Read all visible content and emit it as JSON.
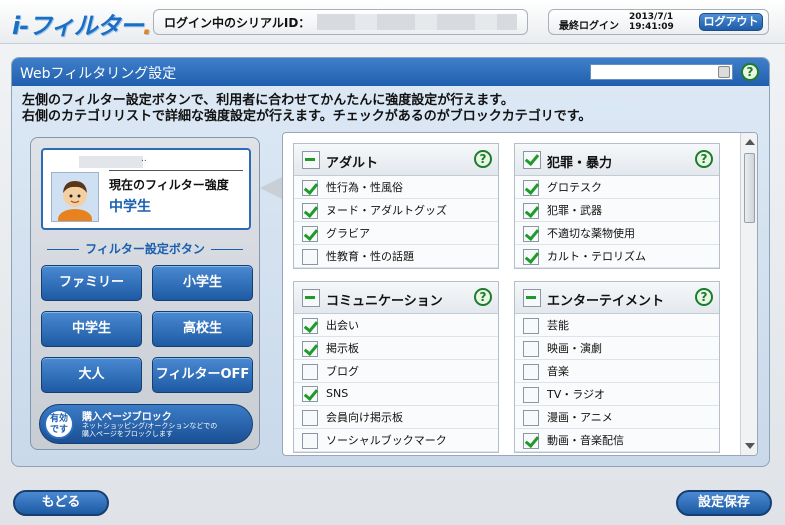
{
  "header": {
    "logo_text": "i-フィルター",
    "logo_dot": ".",
    "serial_label": "ログイン中のシリアルID：",
    "last_login_label": "最終ログイン",
    "last_login_date": "2013/7/1",
    "last_login_time": "19:41:09",
    "logout_label": "ログアウト"
  },
  "panel": {
    "title": "Webフィルタリング設定",
    "help_glyph": "?",
    "instruction_line1": "左側のフィルター設定ボタンで、利用者に合わせてかんたんに強度設定が行えます。",
    "instruction_line2": "右側のカテゴリリストで詳細な強度設定が行えます。チェックがあるのがブロックカテゴリです。"
  },
  "current_filter": {
    "dots": "..",
    "label": "現在のフィルター強度",
    "value": "中学生"
  },
  "filter_buttons": {
    "section_title": "フィルター設定ボタン",
    "family": "ファミリー",
    "elementary": "小学生",
    "junior_high": "中学生",
    "high_school": "高校生",
    "adult": "大人",
    "off": "フィルターOFF"
  },
  "purchase_block": {
    "badge_line1": "有効",
    "badge_line2": "です",
    "title": "購入ページブロック",
    "desc_line1": "ネットショッピング/オークションなどでの",
    "desc_line2": "購入ページをブロックします"
  },
  "categories": {
    "adult": {
      "title": "アダルト",
      "items": [
        {
          "label": "性行為・性風俗",
          "checked": true
        },
        {
          "label": "ヌード・アダルトグッズ",
          "checked": true
        },
        {
          "label": "グラビア",
          "checked": true
        },
        {
          "label": "性教育・性の話題",
          "checked": false
        }
      ]
    },
    "crime": {
      "title": "犯罪・暴力",
      "items": [
        {
          "label": "グロテスク",
          "checked": true
        },
        {
          "label": "犯罪・武器",
          "checked": true
        },
        {
          "label": "不適切な薬物使用",
          "checked": true
        },
        {
          "label": "カルト・テロリズム",
          "checked": true
        }
      ]
    },
    "communication": {
      "title": "コミュニケーション",
      "items": [
        {
          "label": "出会い",
          "checked": true
        },
        {
          "label": "掲示板",
          "checked": true
        },
        {
          "label": "ブログ",
          "checked": false
        },
        {
          "label": "SNS",
          "checked": true
        },
        {
          "label": "会員向け掲示板",
          "checked": false
        },
        {
          "label": "ソーシャルブックマーク",
          "checked": false
        }
      ]
    },
    "entertainment": {
      "title": "エンターテイメント",
      "items": [
        {
          "label": "芸能",
          "checked": false
        },
        {
          "label": "映画・演劇",
          "checked": false
        },
        {
          "label": "音楽",
          "checked": false
        },
        {
          "label": "TV・ラジオ",
          "checked": false
        },
        {
          "label": "漫画・アニメ",
          "checked": false
        },
        {
          "label": "動画・音楽配信",
          "checked": true
        }
      ]
    }
  },
  "footer": {
    "back_label": "もどる",
    "save_label": "設定保存"
  },
  "colors": {
    "accent_blue": "#1f5fae",
    "check_green": "#1e9b2a",
    "logo_orange": "#e8821e"
  }
}
